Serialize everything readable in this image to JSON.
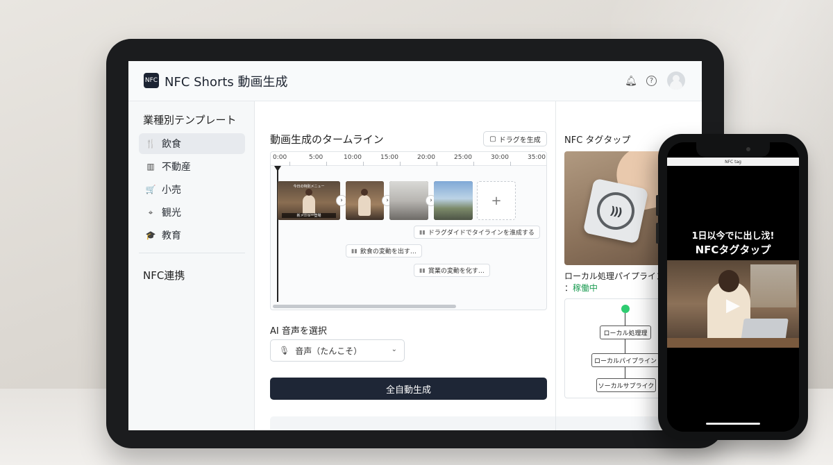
{
  "app": {
    "logo": "NFC",
    "title": "NFC Shorts 動画生成"
  },
  "header_icons": [
    "bell-icon",
    "help-icon",
    "avatar"
  ],
  "sidebar": {
    "title": "業種別テンプレート",
    "items": [
      {
        "label": "飲食",
        "icon": "utensils-icon",
        "glyph": "🍴",
        "active": true
      },
      {
        "label": "不動産",
        "icon": "building-icon",
        "glyph": "▥",
        "active": false
      },
      {
        "label": "小売",
        "icon": "cart-icon",
        "glyph": "🛒",
        "active": false
      },
      {
        "label": "観光",
        "icon": "map-pin-icon",
        "glyph": "⌖",
        "active": false
      },
      {
        "label": "教育",
        "icon": "graduation-cap-icon",
        "glyph": "🎓",
        "active": false
      }
    ],
    "nfc_link": "NFC連携"
  },
  "timeline": {
    "title": "動画生成のタームライン",
    "drag_button": "ドラグを生成",
    "ticks": [
      "0:00",
      "5:00",
      "10:00",
      "15:00",
      "20:00",
      "25:00",
      "30:00",
      "35:00"
    ],
    "clip_caption": "今日の特別メニュー",
    "clip_subtitle": "新メニュー登場",
    "audio_tracks": [
      "ドラグダイドでタイラインを淮成する",
      "飲食の変動を出す…",
      "賞業の変動を化す…"
    ]
  },
  "voice": {
    "title": "AI 音声を選択",
    "selected": "音声（たんこそ）"
  },
  "generate_button": "全自動生成",
  "nfc_panel": {
    "title": "NFC タグタップ",
    "pipeline_title": "ローカル処理パイプライン",
    "pipeline_status_prefix": "：",
    "pipeline_status": "稼働中",
    "status_color": "#1f9d55",
    "flow_nodes": [
      "ローカル処理理",
      "ローカルパイプライン",
      "ソーカルサプライク"
    ]
  },
  "phone": {
    "topbar": "NFC tag",
    "promo_line1": "1日以今でに出し㳀!",
    "promo_line2": "NFCタグタップ"
  }
}
